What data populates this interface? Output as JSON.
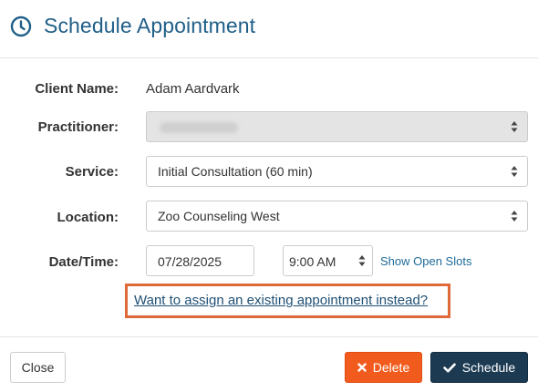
{
  "dialog": {
    "title": "Schedule Appointment",
    "title_icon": "clock-icon"
  },
  "form": {
    "client_name": {
      "label": "Client Name:",
      "value": "Adam Aardvark"
    },
    "practitioner": {
      "label": "Practitioner:",
      "value_obscured": true
    },
    "service": {
      "label": "Service:",
      "value": "Initial Consultation (60 min)"
    },
    "location": {
      "label": "Location:",
      "value": "Zoo Counseling West"
    },
    "datetime": {
      "label": "Date/Time:",
      "date": "07/28/2025",
      "time": "9:00 AM",
      "show_slots_link": "Show Open Slots"
    },
    "assign_link": "Want to assign an existing appointment instead?"
  },
  "footer": {
    "close_label": "Close",
    "delete_label": "Delete",
    "delete_icon": "x-icon",
    "schedule_label": "Schedule",
    "schedule_icon": "checkmark-icon"
  },
  "colors": {
    "title": "#1f5f88",
    "highlight_border": "#e0693a",
    "delete_bg": "#f15c1e",
    "schedule_bg": "#1c3a52",
    "link": "#1f6b9a"
  }
}
